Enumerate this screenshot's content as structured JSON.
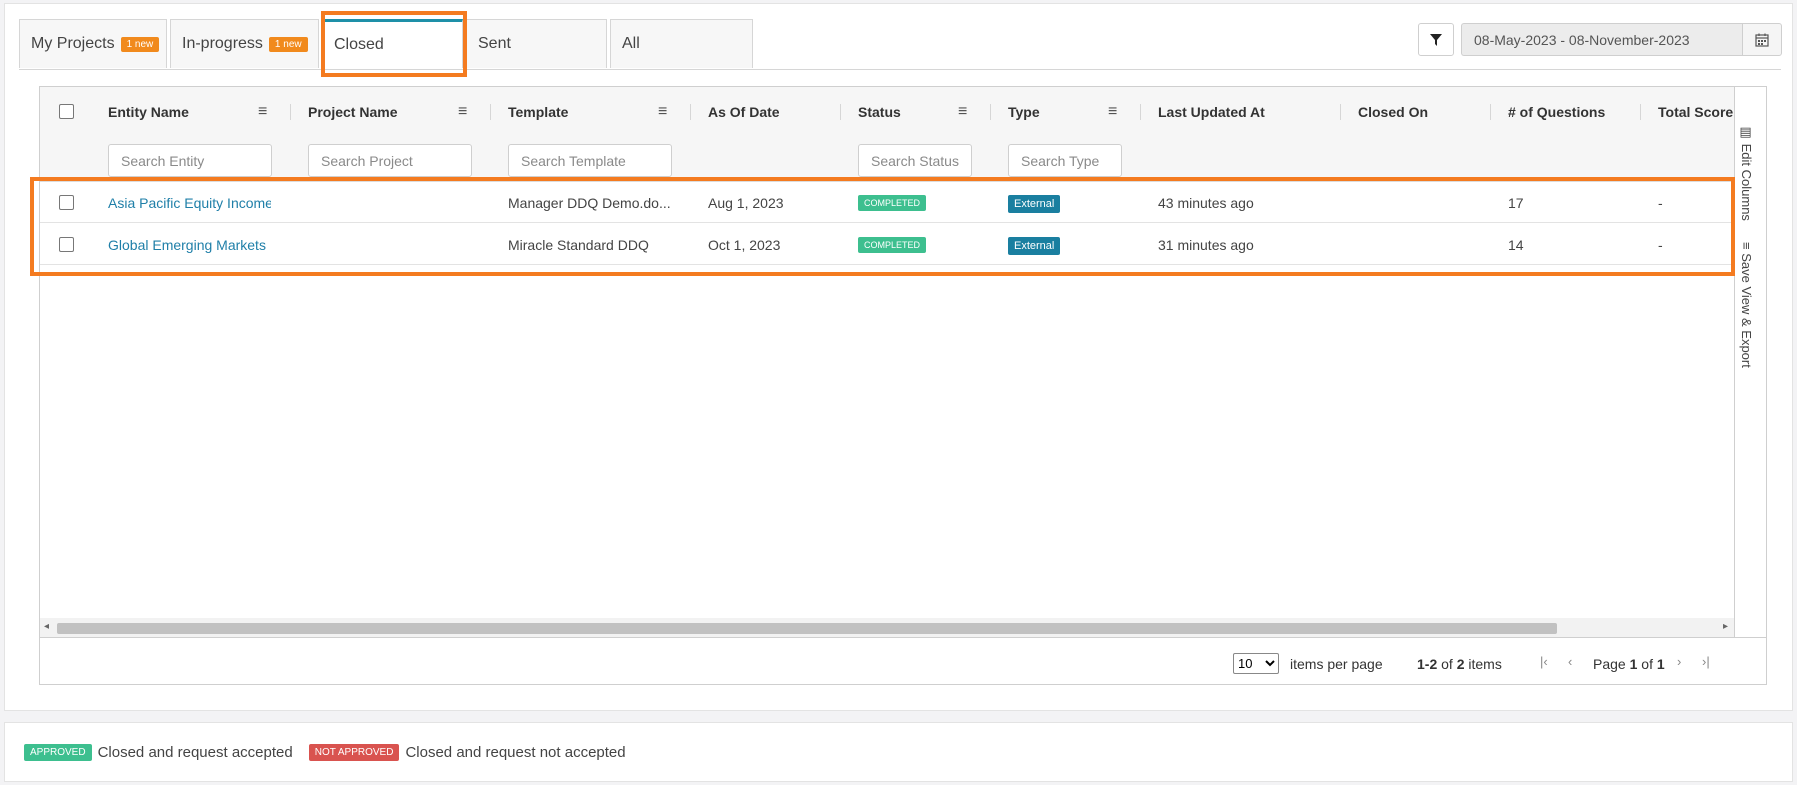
{
  "tabs": [
    {
      "label": "My Projects",
      "badge": "1 new"
    },
    {
      "label": "In-progress",
      "badge": "1 new"
    },
    {
      "label": "Closed",
      "badge": ""
    },
    {
      "label": "Sent",
      "badge": ""
    },
    {
      "label": "All",
      "badge": ""
    }
  ],
  "date_range": "08-May-2023 - 08-November-2023",
  "columns": {
    "entity": "Entity Name",
    "project": "Project Name",
    "template": "Template",
    "as_of": "As Of Date",
    "status": "Status",
    "type": "Type",
    "updated": "Last Updated At",
    "closed": "Closed On",
    "questions": "# of Questions",
    "score": "Total Score"
  },
  "search": {
    "entity": "Search Entity",
    "project": "Search Project",
    "template": "Search Template",
    "status": "Search Status",
    "type": "Search Type"
  },
  "rows": [
    {
      "entity": "Asia Pacific Equity Income",
      "project": "",
      "template": "Manager DDQ Demo.do...",
      "as_of": "Aug 1, 2023",
      "status": "COMPLETED",
      "type": "External",
      "updated": "43 minutes ago",
      "closed": "",
      "questions": "17",
      "score": "-"
    },
    {
      "entity": "Global Emerging Markets I",
      "project": "",
      "template": "Miracle Standard DDQ",
      "as_of": "Oct 1, 2023",
      "status": "COMPLETED",
      "type": "External",
      "updated": "31 minutes ago",
      "closed": "",
      "questions": "14",
      "score": "-"
    }
  ],
  "side": {
    "edit_columns": "Edit Columns",
    "save_view": "Save View & Export"
  },
  "pager": {
    "page_size": "10",
    "items_per_page": "items per page",
    "range": "1-2",
    "of_word": "of",
    "total": "2",
    "items_word": "items",
    "page_word": "Page",
    "page": "1",
    "page_of": "of",
    "pages": "1"
  },
  "legend": [
    {
      "badge": "APPROVED",
      "text": "Closed and request accepted",
      "color": "#3dbf8f"
    },
    {
      "badge": "NOT APPROVED",
      "text": "Closed and request not accepted",
      "color": "#d9534f"
    }
  ],
  "colors": {
    "accent": "#1e90a8",
    "highlight": "#f47b20",
    "new_badge": "#f18a1d",
    "link": "#1f7fa8"
  }
}
